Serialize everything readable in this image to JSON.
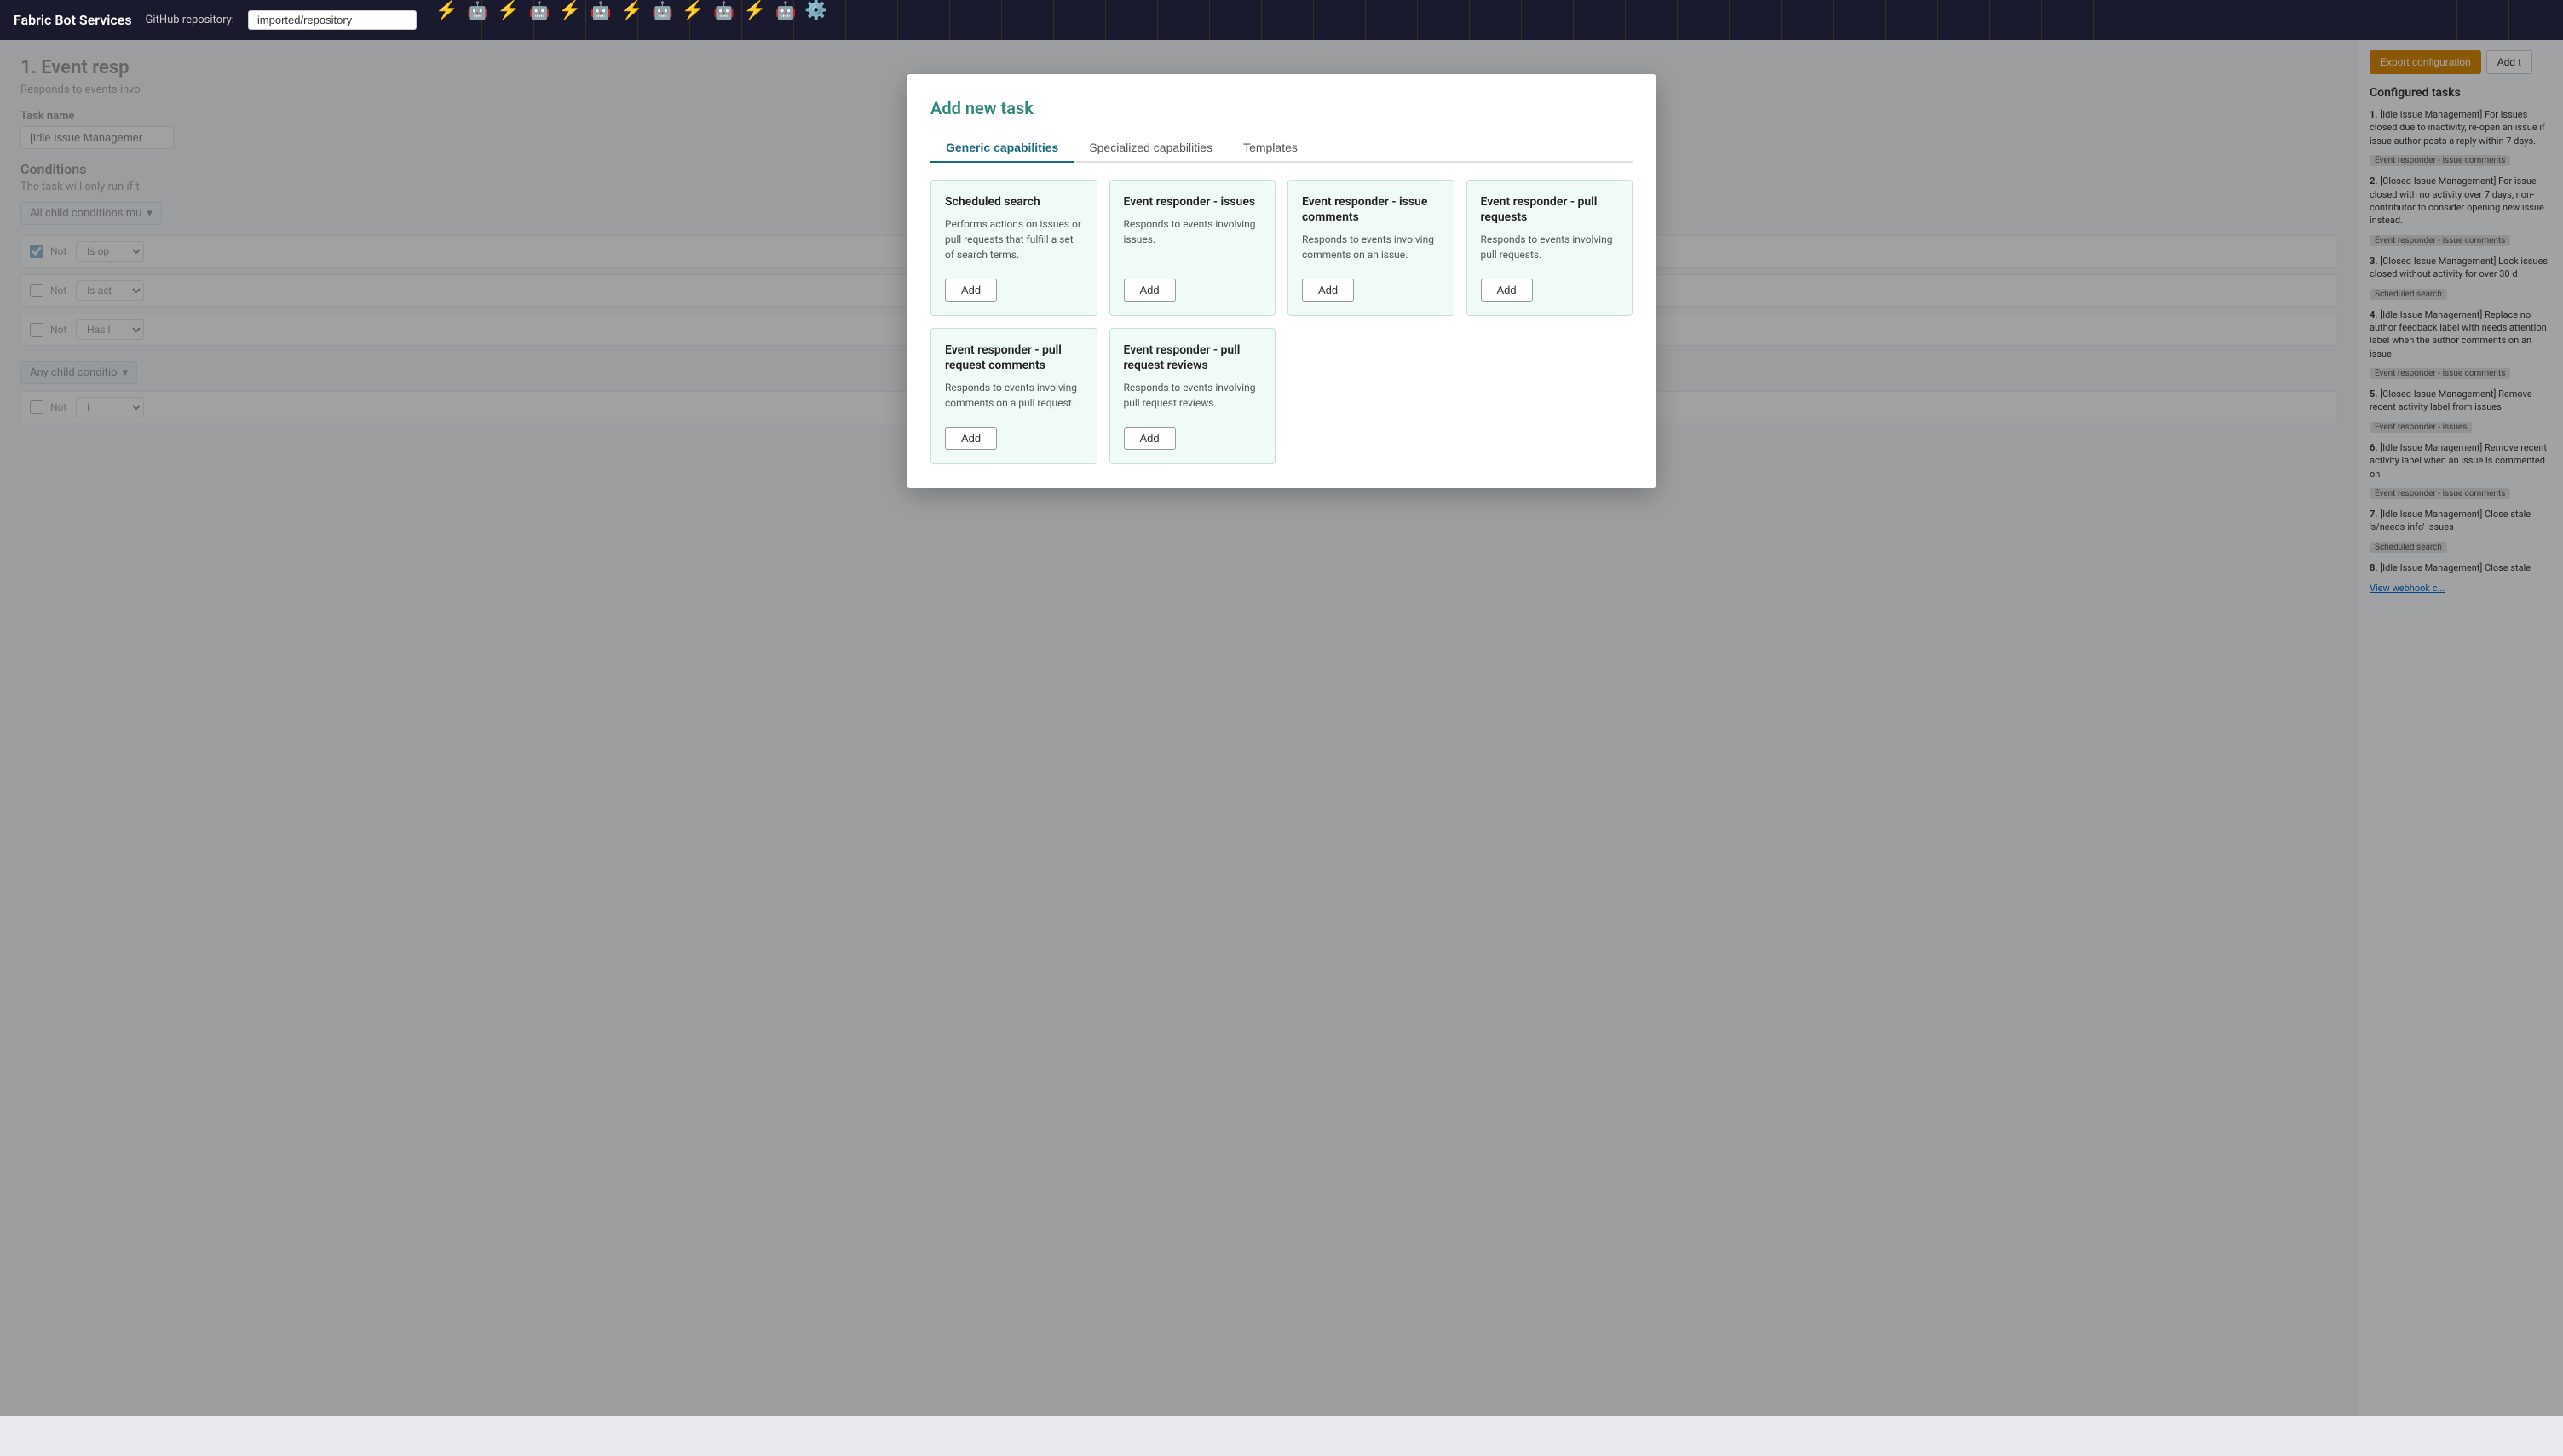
{
  "header": {
    "brand": "Fabric Bot Services",
    "repo_label": "GitHub repository:",
    "repo_value": "imported/repository"
  },
  "sidebar": {
    "export_btn": "Export configuration",
    "add_btn": "Add t",
    "configured_title": "Configured tasks",
    "items": [
      {
        "number": "1.",
        "text": "[Idle Issue Management] For issues closed due to inactivity, re-open an issue if issue author posts a reply within 7 days.",
        "badge": "Event responder - issue comments"
      },
      {
        "number": "2.",
        "text": "[Closed Issue Management] For issue closed with no activity over 7 days, non-contributor to consider opening new issue instead.",
        "badge": "Event responder - issue comments"
      },
      {
        "number": "3.",
        "text": "[Closed Issue Management] Lock issues closed without activity for over 30 d",
        "badge": "Scheduled search"
      },
      {
        "number": "4.",
        "text": "[Idle Issue Management] Replace no author feedback label with needs attention label when the author comments on an issue",
        "badge": "Event responder - issue comments"
      },
      {
        "number": "5.",
        "text": "[Closed Issue Management] Remove recent activity label from issues",
        "badge": "Event responder - issues"
      },
      {
        "number": "6.",
        "text": "[Idle Issue Management] Remove recent activity label when an issue is commented on",
        "badge": "Event responder - issue comments"
      },
      {
        "number": "7.",
        "text": "[Idle Issue Management] Close stale 's/needs-info' issues",
        "badge": "Scheduled search"
      },
      {
        "number": "8.",
        "text": "[Idle Issue Management] Close stale",
        "badge": ""
      }
    ],
    "view_webhook": "View webhook c..."
  },
  "bg_content": {
    "page_title": "1. Event resp",
    "page_subtitle": "Responds to events invo",
    "task_name_label": "Task name",
    "task_name_value": "[Idle Issue Managemer",
    "conditions_title": "Conditions",
    "conditions_subtitle": "The task will only run if t",
    "all_child_label": "All child conditions mu",
    "any_child_label": "Any child conditio",
    "condition_rows": [
      {
        "checked": true,
        "not_label": "Not",
        "dropdown": "Is op"
      },
      {
        "checked": false,
        "not_label": "Not",
        "dropdown": "Is act"
      },
      {
        "checked": false,
        "not_label": "Not",
        "dropdown": "Has l"
      },
      {
        "checked": false,
        "not_label": "Not",
        "dropdown": "I"
      }
    ]
  },
  "modal": {
    "title": "Add new task",
    "tabs": [
      {
        "label": "Generic capabilities",
        "active": true
      },
      {
        "label": "Specialized capabilities",
        "active": false
      },
      {
        "label": "Templates",
        "active": false
      }
    ],
    "cards": [
      {
        "title": "Scheduled search",
        "desc": "Performs actions on issues or pull requests that fulfill a set of search terms.",
        "add_label": "Add"
      },
      {
        "title": "Event responder - issues",
        "desc": "Responds to events involving issues.",
        "add_label": "Add"
      },
      {
        "title": "Event responder - issue comments",
        "desc": "Responds to events involving comments on an issue.",
        "add_label": "Add"
      },
      {
        "title": "Event responder - pull requests",
        "desc": "Responds to events involving pull requests.",
        "add_label": "Add"
      },
      {
        "title": "Event responder - pull request comments",
        "desc": "Responds to events involving comments on a pull request.",
        "add_label": "Add"
      },
      {
        "title": "Event responder - pull request reviews",
        "desc": "Responds to events involving pull request reviews.",
        "add_label": "Add"
      }
    ]
  }
}
